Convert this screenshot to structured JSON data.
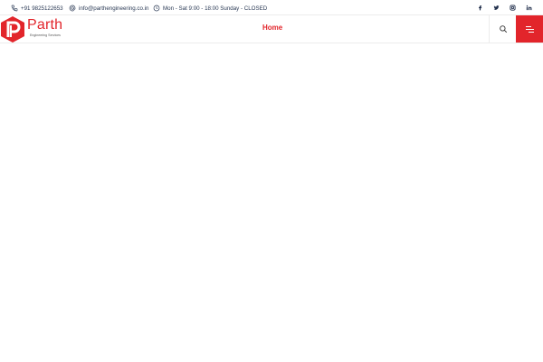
{
  "topbar": {
    "phone": "+91 9825122653",
    "email": "info@parthengineering.co.in",
    "hours": "Mon - Sat 9:00 - 18:00 Sunday - CLOSED",
    "social": [
      "facebook-icon",
      "twitter-icon",
      "instagram-icon",
      "linkedin-icon"
    ]
  },
  "header": {
    "brand": "Parth",
    "tagline": "Engineering Services",
    "nav": {
      "home": "Home"
    }
  },
  "colors": {
    "accent": "#e2252b",
    "text_dark": "#2b3a55"
  }
}
